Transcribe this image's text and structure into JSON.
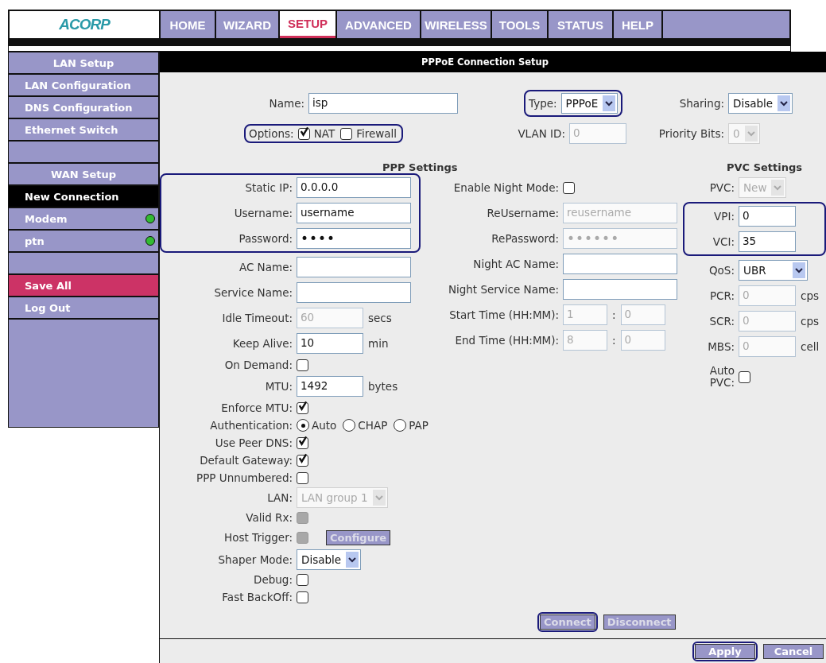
{
  "logo": "ACORP",
  "nav": [
    {
      "label": "HOME",
      "selected": false
    },
    {
      "label": "WIZARD",
      "selected": false
    },
    {
      "label": "SETUP",
      "selected": true
    },
    {
      "label": "ADVANCED",
      "selected": false
    },
    {
      "label": "WIRELESS",
      "selected": false
    },
    {
      "label": "TOOLS",
      "selected": false
    },
    {
      "label": "STATUS",
      "selected": false
    },
    {
      "label": "HELP",
      "selected": false
    }
  ],
  "sidebar": [
    {
      "kind": "header",
      "label": "LAN Setup"
    },
    {
      "kind": "link",
      "label": "LAN Configuration",
      "selected": false
    },
    {
      "kind": "link",
      "label": "DNS Configuration",
      "selected": false
    },
    {
      "kind": "link",
      "label": "Ethernet Switch",
      "selected": false
    },
    {
      "kind": "spacer"
    },
    {
      "kind": "header",
      "label": "WAN Setup"
    },
    {
      "kind": "link",
      "label": "New Connection",
      "selected": true
    },
    {
      "kind": "link",
      "label": "Modem",
      "selected": false,
      "color": "#33bb33"
    },
    {
      "kind": "link",
      "label": "ptn",
      "selected": false,
      "color": "#33bb33"
    },
    {
      "kind": "spacer"
    },
    {
      "kind": "save",
      "label": "Save All"
    },
    {
      "kind": "link",
      "label": "Log Out",
      "selected": false
    }
  ],
  "panel_title": "PPPoE Connection Setup",
  "top": {
    "name": {
      "label": "Name:",
      "value": "isp"
    },
    "options": {
      "label": "Options:",
      "highlighted": true,
      "items": [
        {
          "label": "NAT",
          "checked": true
        },
        {
          "label": "Firewall",
          "checked": false
        }
      ]
    },
    "type": {
      "label": "Type:",
      "value": "PPPoE",
      "highlighted": true
    },
    "sharing": {
      "label": "Sharing:",
      "value": "Disable",
      "disabled": false
    },
    "vlan": {
      "label": "VLAN ID:",
      "value": "0",
      "disabled": true
    },
    "priority": {
      "label": "Priority Bits:",
      "value": "0",
      "disabled": true
    }
  },
  "ppp": {
    "title": "PPP Settings",
    "left": [
      {
        "highlighted": true,
        "rows": [
          {
            "kind": "text",
            "label": "Static IP:",
            "value": "0.0.0.0",
            "disabled": false
          },
          {
            "kind": "text",
            "label": "Username:",
            "value": "username",
            "disabled": false
          },
          {
            "kind": "text",
            "label": "Password:",
            "value": "••••",
            "disabled": false
          }
        ]
      },
      {
        "highlighted": false,
        "rows": [
          {
            "kind": "text",
            "label": "AC Name:",
            "value": "",
            "disabled": false
          },
          {
            "kind": "text",
            "label": "Service Name:",
            "value": "",
            "disabled": false
          },
          {
            "kind": "short",
            "label": "Idle Timeout:",
            "value": "60",
            "unit": "secs",
            "disabled": true
          },
          {
            "kind": "short",
            "label": "Keep Alive:",
            "value": "10",
            "unit": "min",
            "disabled": false
          },
          {
            "kind": "check",
            "label": "On Demand:",
            "checked": false,
            "disabled": false
          },
          {
            "kind": "short",
            "label": "MTU:",
            "value": "1492",
            "unit": "bytes",
            "disabled": false
          },
          {
            "kind": "check",
            "label": "Enforce MTU:",
            "checked": true,
            "disabled": false
          },
          {
            "kind": "radio",
            "label": "Authentication:",
            "options": [
              {
                "label": "Auto",
                "selected": true
              },
              {
                "label": "CHAP",
                "selected": false
              },
              {
                "label": "PAP",
                "selected": false
              }
            ]
          },
          {
            "kind": "check",
            "label": "Use Peer DNS:",
            "checked": true,
            "disabled": false
          },
          {
            "kind": "check",
            "label": "Default Gateway:",
            "checked": true,
            "disabled": false
          },
          {
            "kind": "check",
            "label": "PPP Unnumbered:",
            "checked": false,
            "disabled": false
          },
          {
            "kind": "select",
            "label": "LAN:",
            "value": "LAN group 1",
            "disabled": true
          },
          {
            "kind": "check",
            "label": "Valid Rx:",
            "checked": false,
            "disabled": true
          },
          {
            "kind": "check_button",
            "label": "Host Trigger:",
            "checked": false,
            "disabled": true,
            "button": "Configure"
          },
          {
            "kind": "select",
            "label": "Shaper Mode:",
            "value": "Disable",
            "disabled": false
          },
          {
            "kind": "check",
            "label": "Debug:",
            "checked": false,
            "disabled": false
          },
          {
            "kind": "check",
            "label": "Fast BackOff:",
            "checked": false,
            "disabled": false
          }
        ]
      }
    ],
    "middle": [
      {
        "highlighted": false,
        "rows": [
          {
            "kind": "check",
            "label": "Enable Night Mode:",
            "checked": false,
            "disabled": false
          },
          {
            "kind": "text",
            "label": "ReUsername:",
            "value": "reusername",
            "disabled": true
          },
          {
            "kind": "text",
            "label": "RePassword:",
            "value": "••••••",
            "disabled": true
          },
          {
            "kind": "text",
            "label": "Night AC Name:",
            "value": "",
            "disabled": false
          },
          {
            "kind": "text",
            "label": "Night Service Name:",
            "value": "",
            "disabled": false
          },
          {
            "kind": "time",
            "label": "Start Time (HH:MM):",
            "values": [
              "1",
              "0"
            ],
            "separator": ":",
            "disabled": true
          },
          {
            "kind": "time",
            "label": "End Time (HH:MM):",
            "values": [
              "8",
              "0"
            ],
            "separator": ":",
            "disabled": true
          }
        ]
      }
    ]
  },
  "pvc": {
    "title": "PVC Settings",
    "groups": [
      {
        "highlighted": false,
        "rows": [
          {
            "kind": "select",
            "label": "PVC:",
            "value": "New",
            "disabled": true
          }
        ]
      },
      {
        "highlighted": true,
        "rows": [
          {
            "kind": "short",
            "label": "VPI:",
            "value": "0",
            "disabled": false
          },
          {
            "kind": "short",
            "label": "VCI:",
            "value": "35",
            "disabled": false
          }
        ]
      },
      {
        "highlighted": false,
        "rows": [
          {
            "kind": "select",
            "label": "QoS:",
            "value": "UBR",
            "disabled": false
          },
          {
            "kind": "short",
            "label": "PCR:",
            "value": "0",
            "unit": "cps",
            "disabled": true
          },
          {
            "kind": "short",
            "label": "SCR:",
            "value": "0",
            "unit": "cps",
            "disabled": true
          },
          {
            "kind": "short",
            "label": "MBS:",
            "value": "0",
            "unit": "cell",
            "disabled": true
          },
          {
            "kind": "check",
            "label": "Auto PVC:",
            "checked": false,
            "disabled": false
          }
        ]
      }
    ]
  },
  "connection_buttons": [
    {
      "label": "Connect",
      "disabled": true,
      "highlighted": true
    },
    {
      "label": "Disconnect",
      "disabled": true,
      "highlighted": false
    }
  ],
  "form_buttons": [
    {
      "label": "Apply",
      "disabled": false,
      "highlighted": true
    },
    {
      "label": "Cancel",
      "disabled": false,
      "highlighted": false
    }
  ]
}
